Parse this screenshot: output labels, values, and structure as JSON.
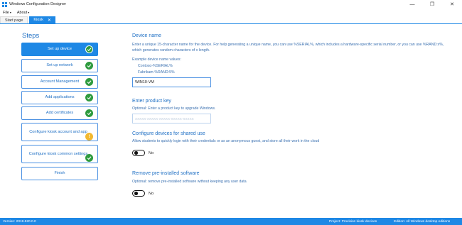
{
  "window": {
    "title": "Windows Configuration Designer",
    "controls": [
      "—",
      "❐",
      "✕"
    ]
  },
  "menu": [
    {
      "label": "File"
    },
    {
      "label": "About"
    }
  ],
  "tabs": {
    "start_page": "Start page",
    "kiosk": "Kiosk",
    "close_glyph": "✕"
  },
  "sidebar": {
    "title": "Steps",
    "items": [
      {
        "label": "Set up device",
        "status": "complete",
        "active": true
      },
      {
        "label": "Set up network",
        "status": "complete",
        "active": false
      },
      {
        "label": "Account Management",
        "status": "complete",
        "active": false
      },
      {
        "label": "Add applications",
        "status": "complete",
        "active": false
      },
      {
        "label": "Add certificates",
        "status": "complete",
        "active": false
      },
      {
        "label": "Configure kiosk account and app",
        "status": "warning",
        "active": false
      },
      {
        "label": "Configure kiosk common settings",
        "status": "complete",
        "active": false
      },
      {
        "label": "Finish",
        "status": "none",
        "active": false
      }
    ],
    "warning_glyph": "!"
  },
  "device_name": {
    "title": "Device name",
    "description": "Enter a unique 15-character name for the device. For help generating a unique name, you can use %SERIAL%, which includes a hardware-specific serial number, or you can use %RAND:x%, which generates random characters of x length.",
    "examples_label": "Example device name values:",
    "example_1": "Contoso-%SERIAL%",
    "example_2": "Fabrikam-%RAND:5%",
    "value": "WIN10-VM"
  },
  "product_key": {
    "title": "Enter product key",
    "description": "Optional: Enter a product key to upgrade Windows.",
    "placeholder": "XXXXX-XXXXX-XXXXX-XXXXX-XXXXX"
  },
  "shared_use": {
    "title": "Configure devices for shared use",
    "description": "Allow students to quickly login with their credentials or as an anonymous guest, and store all their work in the cloud",
    "toggle_label": "No",
    "toggle_on": false
  },
  "preinstalled": {
    "title": "Remove pre-installed software",
    "description": "Optional: remove pre-installed software without keeping any user data",
    "toggle_label": "No",
    "toggle_on": false
  },
  "status": {
    "version": "Version: 2019.520.0.0",
    "project": "Project: Provision kiosk devices",
    "edition": "Edition: All Windows desktop editions"
  },
  "colors": {
    "accent": "#1e88e5",
    "check": "#2e9b3e",
    "warning": "#f2b830"
  }
}
